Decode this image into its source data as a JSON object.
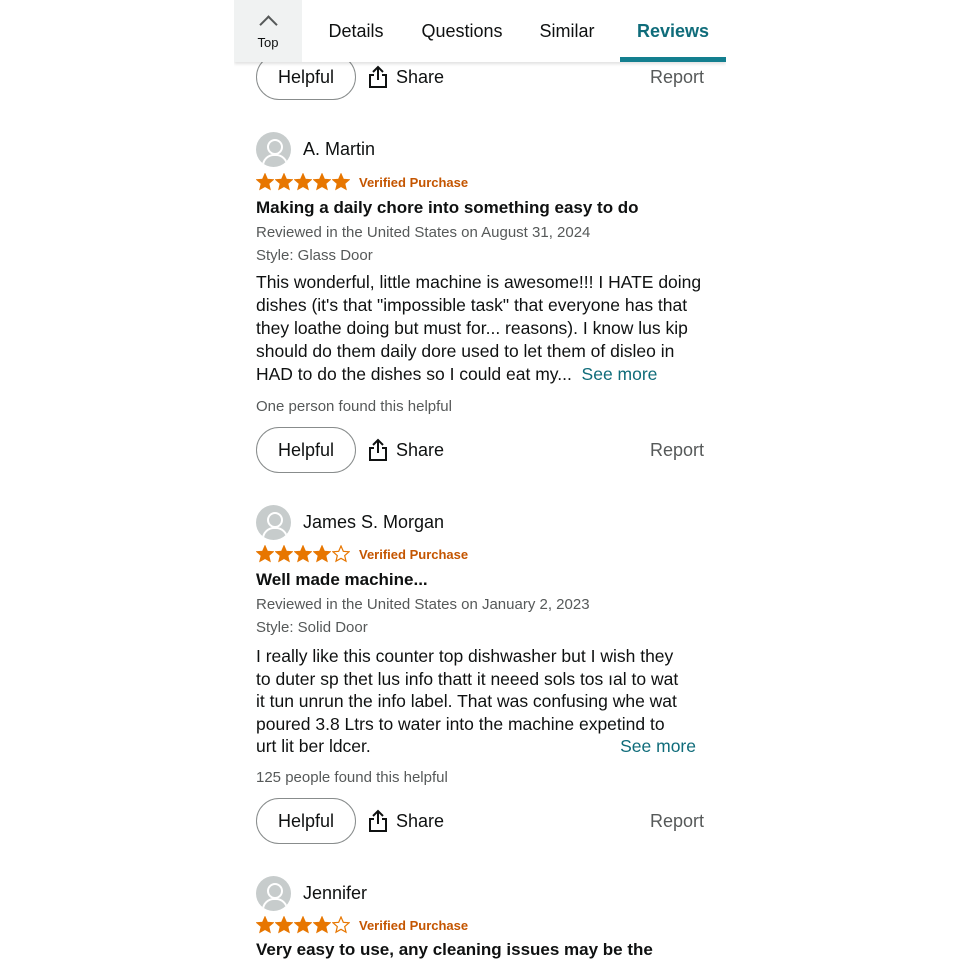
{
  "nav": {
    "top_label": "Top",
    "tabs": [
      {
        "label": "Details"
      },
      {
        "label": "Questions"
      },
      {
        "label": "Similar"
      },
      {
        "label": "Reviews"
      }
    ],
    "active_tab": "Reviews"
  },
  "actions": {
    "helpful_label": "Helpful",
    "share_label": "Share",
    "report_label": "Report"
  },
  "colors": {
    "accent": "#137f8f",
    "star": "#e77600",
    "verified": "#c45500",
    "link": "#0f6c7a"
  },
  "reviews": [
    {
      "name": "A. Martin",
      "rating": 5,
      "verified": "Verified Purchase",
      "title": "Making a daily chore into something easy to do",
      "date": "Reviewed in the United States on August 31, 2024",
      "style": "Style: Glass Door",
      "body_lines": [
        "This wonderful, little machine is awesome!!! I HATE doing",
        "dishes (it's that \"impossible task\" that everyone has that",
        "they loathe doing but must for... reasons). I know lus kip",
        "should do them daily dore used to let them of disleo in",
        "HAD to do the dishes so I could eat my..."
      ],
      "see_more": "See more",
      "helpful_count": "One person found this helpful"
    },
    {
      "name": "James S. Morgan",
      "rating": 4,
      "verified": "Verified Purchase",
      "title": "Well made machine...",
      "date": "Reviewed in the United States on January 2, 2023",
      "style": "Style: Solid Door",
      "body_lines": [
        "I really like this counter top dishwasher but I wish they",
        "to duter sp thet lus info thatt it neeed sols tos ıal to wat",
        "it tun unrun the info label. That was confusing whe wat",
        "poured  3.8 Ltrs to water into the machine expetind to",
        "urt lit ber ldcer."
      ],
      "see_more": "See more",
      "helpful_count": "125 people found this helpful"
    },
    {
      "name": "Jennifer",
      "rating": 4,
      "verified": "Verified Purchase",
      "title": "Very easy to use, any cleaning issues may be the"
    }
  ]
}
